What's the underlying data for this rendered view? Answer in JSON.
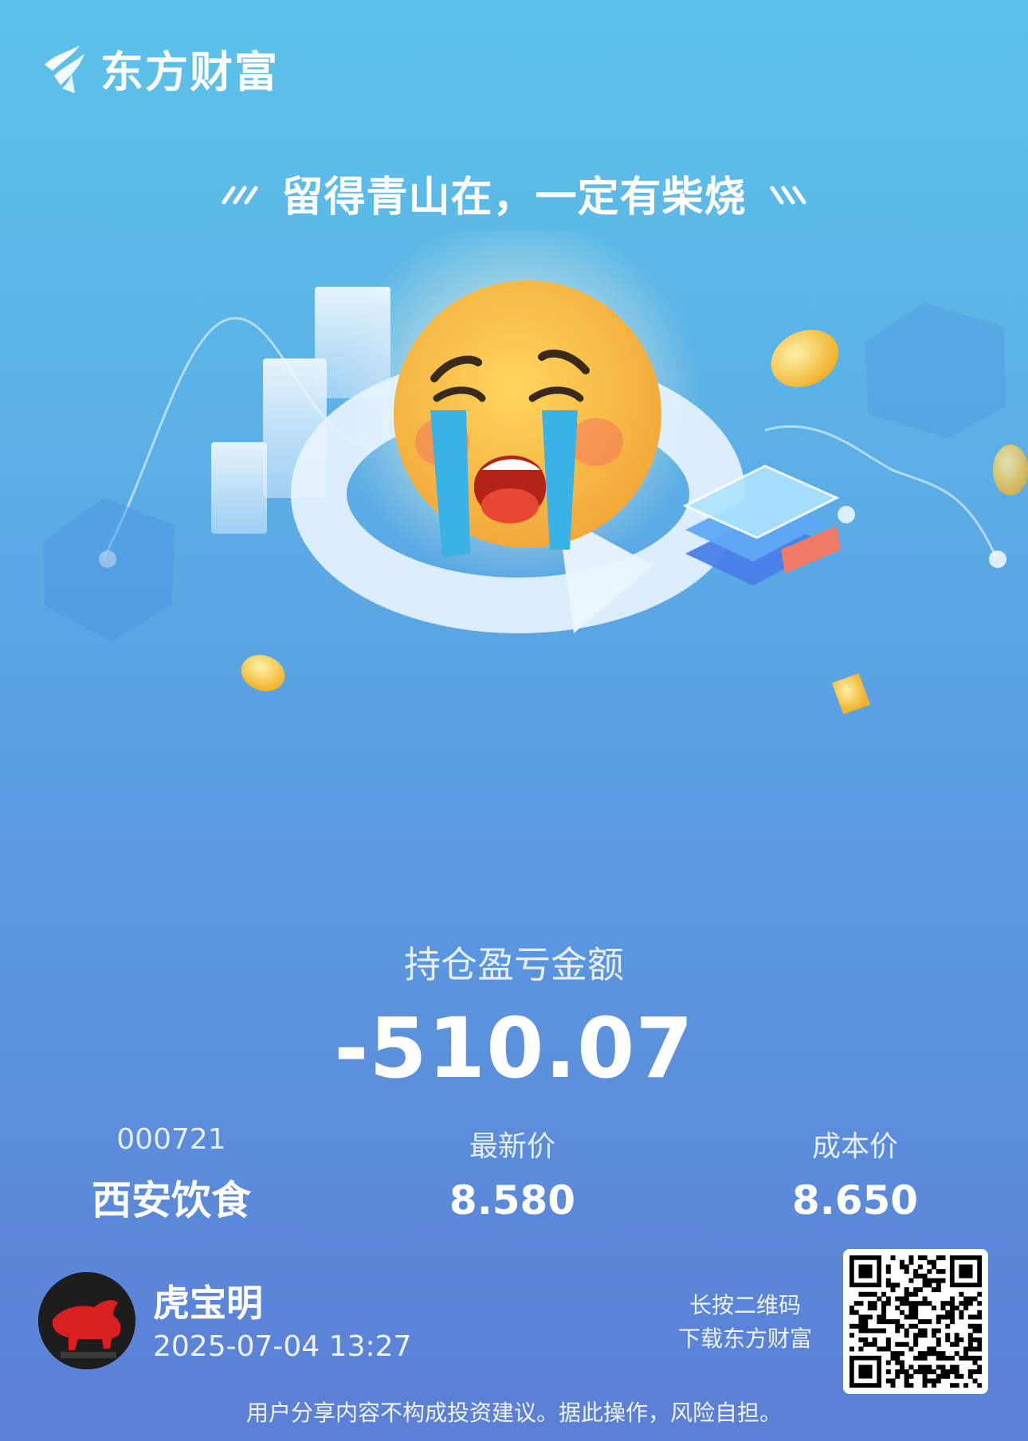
{
  "brand": {
    "name": "东方财富"
  },
  "slogan": "留得青山在，一定有柴烧",
  "pnl": {
    "label": "持仓盈亏金额",
    "value": "-510.07"
  },
  "stock": {
    "code": "000721",
    "name": "西安饮食"
  },
  "latest_price": {
    "label": "最新价",
    "value": "8.580"
  },
  "cost_price": {
    "label": "成本价",
    "value": "8.650"
  },
  "user": {
    "name": "虎宝明",
    "timestamp": "2025-07-04 13:27"
  },
  "qr": {
    "hint_line1": "长按二维码",
    "hint_line2": "下载东方财富"
  },
  "disclaimer": "用户分享内容不构成投资建议。据此操作，风险自担。",
  "colors": {
    "bg_top": "#5cc3ea",
    "bg_bottom": "#5b7fd6",
    "coin": "#f5c542",
    "emoji": "#f7c243",
    "tear": "#39b3e6"
  }
}
